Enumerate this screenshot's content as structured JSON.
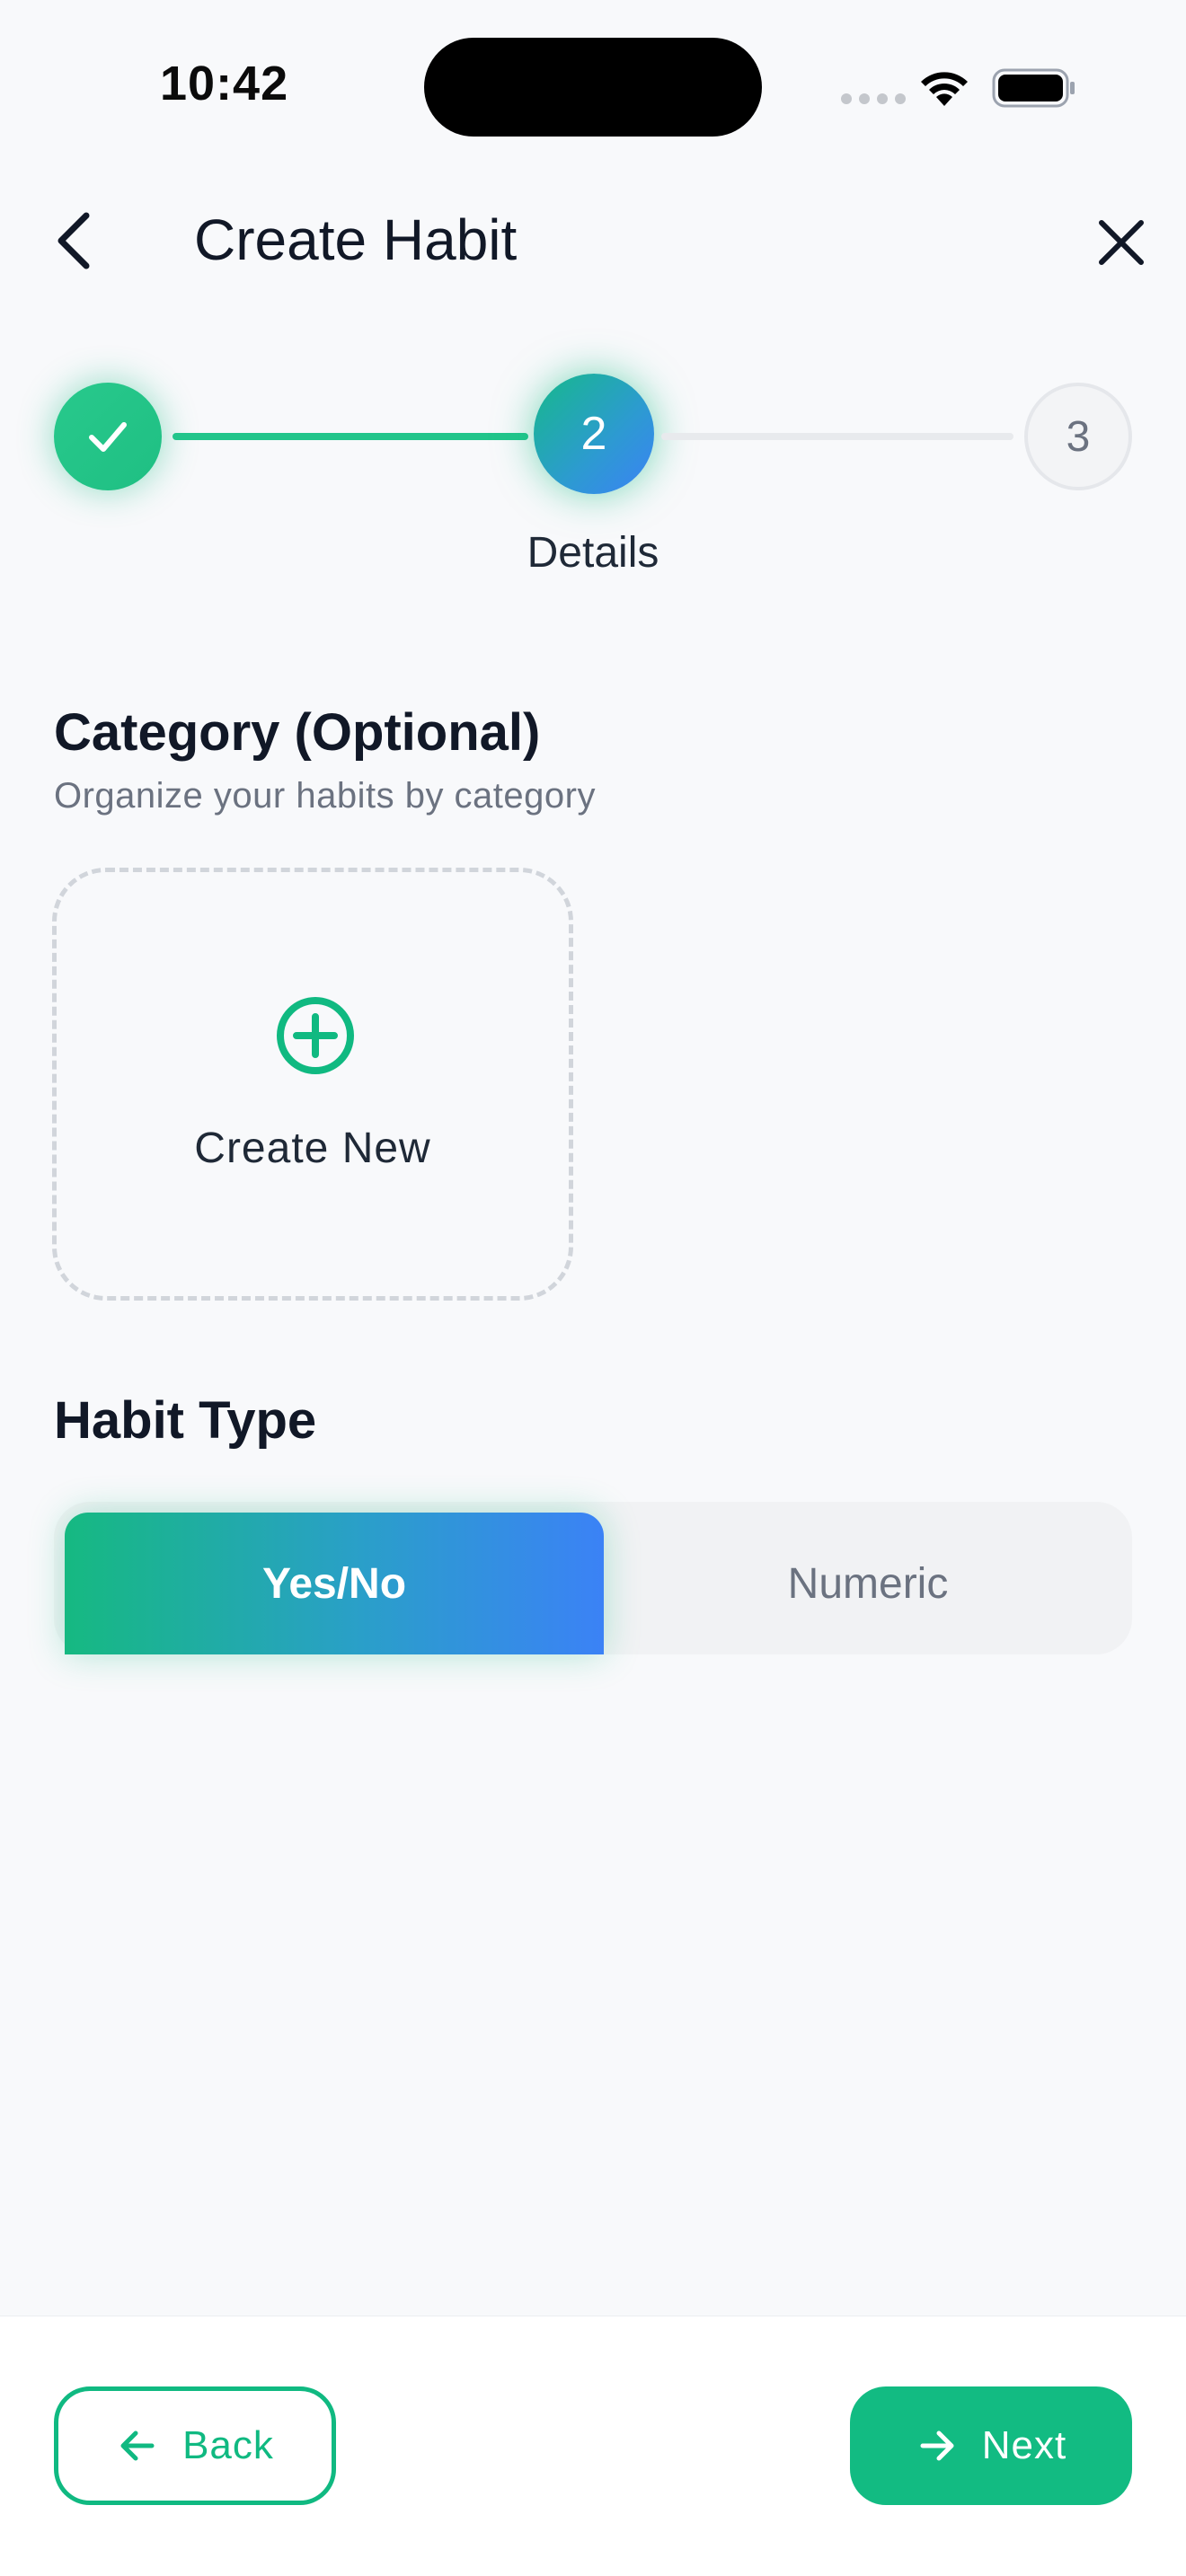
{
  "status_bar": {
    "time": "10:42"
  },
  "header": {
    "title": "Create Habit",
    "back_icon": "chevron-left-icon",
    "close_icon": "close-icon"
  },
  "stepper": {
    "steps": [
      {
        "label": "",
        "state": "done",
        "icon": "check-icon"
      },
      {
        "label": "2",
        "state": "current"
      },
      {
        "label": "3",
        "state": "upcoming"
      }
    ],
    "current_label": "Details"
  },
  "category": {
    "title": "Category (Optional)",
    "subtitle": "Organize your habits by category",
    "create_label": "Create New",
    "create_icon": "plus-circle-icon"
  },
  "habit_type": {
    "title": "Habit Type",
    "options": [
      "Yes/No",
      "Numeric"
    ],
    "selected": "Yes/No"
  },
  "footer": {
    "back_label": "Back",
    "next_label": "Next"
  },
  "colors": {
    "accent": "#10b981",
    "accent_blue": "#3b82f6",
    "text": "#111827",
    "muted": "#6b7280"
  }
}
